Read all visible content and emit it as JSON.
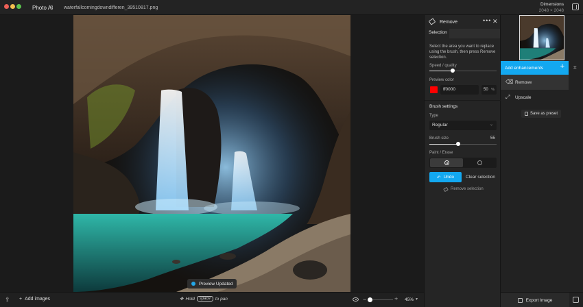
{
  "titlebar": {
    "app_name": "Photo AI",
    "app_version": "3",
    "filename": "waterfallcomingdowndifferen_39510817.png",
    "dimensions_label": "Dimensions",
    "dimensions_value": "2048 × 2048"
  },
  "canvas": {
    "toast": "Preview Updated"
  },
  "bottombar": {
    "add_images": "Add images",
    "hold": "Hold",
    "key": "space",
    "to_pan": "to pan",
    "zoom_value": "45%",
    "zoom_fraction": 0.1
  },
  "remove_panel": {
    "title": "Remove",
    "tab_selection": "Selection",
    "description": "Select the area you want to replace using the brush, then press Remove selection.",
    "speed_quality_label": "Speed / quality",
    "speed_quality_fraction": 0.35,
    "preview_color_label": "Preview color",
    "preview_color_hex": "ff0000",
    "preview_color_opacity": "50",
    "percent": "%",
    "brush_settings_title": "Brush settings",
    "type_label": "Type",
    "type_value": "Regular",
    "brush_size_label": "Brush size",
    "brush_size_value": "55",
    "brush_size_fraction": 0.43,
    "paint_erase_label": "Paint / Erase",
    "undo": "Undo",
    "clear_selection": "Clear selection",
    "remove_selection": "Remove selection"
  },
  "sidebar": {
    "add_enhancements": "Add enhancements",
    "items": [
      {
        "label": "Remove",
        "icon": "eraser-icon"
      },
      {
        "label": "Upscale",
        "icon": "upscale-arrows-icon"
      }
    ],
    "save_as_preset": "Save as preset",
    "export_image": "Export Image"
  },
  "colors": {
    "accent": "#13a8f0",
    "preview_color": "#ff0000"
  }
}
